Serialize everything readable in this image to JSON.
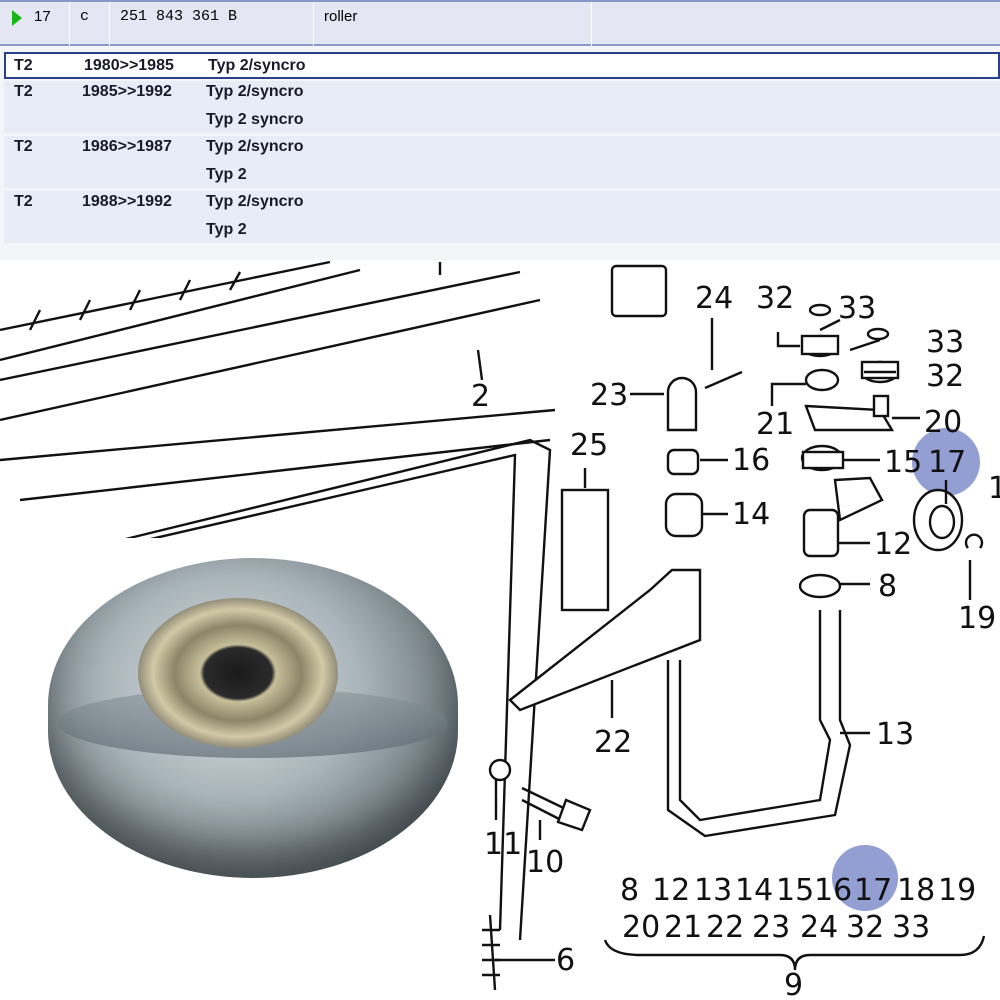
{
  "header_row": {
    "position": "17",
    "code": "c",
    "part_number": "251 843 361 B",
    "description": "roller"
  },
  "vehicles": [
    {
      "model": "T2",
      "years": "1980>>1985",
      "variants": [
        "Typ 2/syncro"
      ]
    },
    {
      "model": "T2",
      "years": "1985>>1992",
      "variants": [
        "Typ 2/syncro",
        "Typ 2 syncro"
      ]
    },
    {
      "model": "T2",
      "years": "1986>>1987",
      "variants": [
        "Typ 2/syncro",
        "Typ 2"
      ]
    },
    {
      "model": "T2",
      "years": "1988>>1992",
      "variants": [
        "Typ 2/syncro",
        "Typ 2"
      ]
    }
  ],
  "diagram": {
    "callouts": [
      "24",
      "32",
      "33",
      "33",
      "32",
      "23",
      "21",
      "20",
      "2",
      "25",
      "16",
      "15",
      "17",
      "1",
      "14",
      "12",
      "8",
      "19",
      "22",
      "13",
      "11",
      "10",
      "6"
    ],
    "highlighted": "17",
    "legend_row1": [
      "8",
      "12",
      "13",
      "14",
      "15",
      "16",
      "17",
      "18",
      "19"
    ],
    "legend_row2": [
      "20",
      "21",
      "22",
      "23",
      "24",
      "32",
      "33"
    ],
    "assembly_number": "9",
    "highlight_color": "#6f7fc4"
  }
}
